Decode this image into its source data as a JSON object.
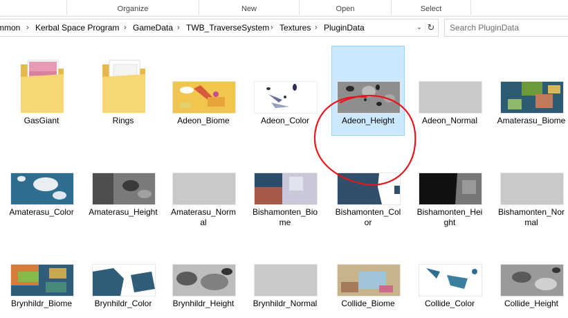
{
  "ribbon": {
    "groups": [
      "Organize",
      "New",
      "Open",
      "Select"
    ]
  },
  "address": {
    "crumbs": [
      "mmon",
      "Kerbal Space Program",
      "GameData",
      "TWB_TraverseSystem",
      "Textures",
      "PluginData"
    ],
    "dropdown_icon": "chevron-down-icon",
    "refresh_icon": "refresh-icon"
  },
  "search": {
    "placeholder": "Search PluginData"
  },
  "items": [
    {
      "label": "GasGiant",
      "kind": "folder"
    },
    {
      "label": "Rings",
      "kind": "folder"
    },
    {
      "label": "Adeon_Biome",
      "kind": "image"
    },
    {
      "label": "Adeon_Color",
      "kind": "image"
    },
    {
      "label": "Adeon_Height",
      "kind": "image",
      "selected": true
    },
    {
      "label": "Adeon_Normal",
      "kind": "image"
    },
    {
      "label": "Amaterasu_Biome",
      "kind": "image"
    },
    {
      "label": "Amaterasu_Color",
      "kind": "image"
    },
    {
      "label": "Amaterasu_Height",
      "kind": "image"
    },
    {
      "label": "Amaterasu_Normal",
      "kind": "image"
    },
    {
      "label": "Bishamonten_Biome",
      "kind": "image"
    },
    {
      "label": "Bishamonten_Color",
      "kind": "image"
    },
    {
      "label": "Bishamonten_Height",
      "kind": "image"
    },
    {
      "label": "Bishamonten_Normal",
      "kind": "image"
    },
    {
      "label": "Brynhildr_Biome",
      "kind": "image"
    },
    {
      "label": "Brynhildr_Color",
      "kind": "image"
    },
    {
      "label": "Brynhildr_Height",
      "kind": "image"
    },
    {
      "label": "Brynhildr_Normal",
      "kind": "image"
    },
    {
      "label": "Collide_Biome",
      "kind": "image"
    },
    {
      "label": "Collide_Color",
      "kind": "image"
    },
    {
      "label": "Collide_Height",
      "kind": "image"
    }
  ],
  "colors": {
    "selection_bg": "#cce8ff",
    "selection_border": "#99d1ff",
    "annotation": "#e8141b",
    "folder": "#f7d774"
  }
}
